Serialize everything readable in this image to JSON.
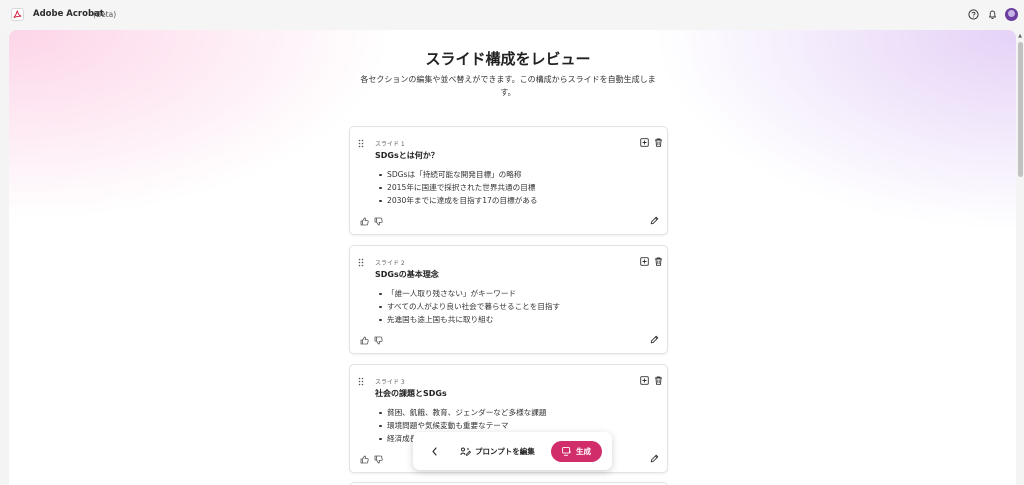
{
  "titlebar": {
    "app_name": "Adobe Acrobat",
    "beta_label": "(Beta)",
    "icons": [
      "acrobat-logo-icon",
      "help-icon",
      "bell-icon",
      "avatar"
    ]
  },
  "header": {
    "title": "スライド構成をレビュー",
    "subtitle": "各セクションの編集や並べ替えができます。この構成からスライドを自動生成します。"
  },
  "slides": [
    {
      "number_label": "スライド 1",
      "title": "SDGsとは何か？",
      "bullets": [
        "SDGsは「持続可能な開発目標」の略称",
        "2015年に国連で採択された世界共通の目標",
        "2030年までに達成を目指す17の目標がある"
      ]
    },
    {
      "number_label": "スライド 2",
      "title": "SDGsの基本理念",
      "bullets": [
        "「誰一人取り残さない」がキーワード",
        "すべての人がより良い社会で暮らせることを目指す",
        "先進国も途上国も共に取り組む"
      ]
    },
    {
      "number_label": "スライド 3",
      "title": "社会の課題とSDGs",
      "bullets": [
        "貧困、飢餓、教育、ジェンダーなど多様な課題",
        "環境問題や気候変動も重要なテーマ",
        "経済成長"
      ]
    }
  ],
  "prompt_bar": {
    "edit_prompt_label": "プロンプトを編集",
    "generate_label": "生成"
  },
  "colors": {
    "accent": "#d22d6b",
    "avatar": "#6a3fa0",
    "logo": "#c8102e"
  }
}
